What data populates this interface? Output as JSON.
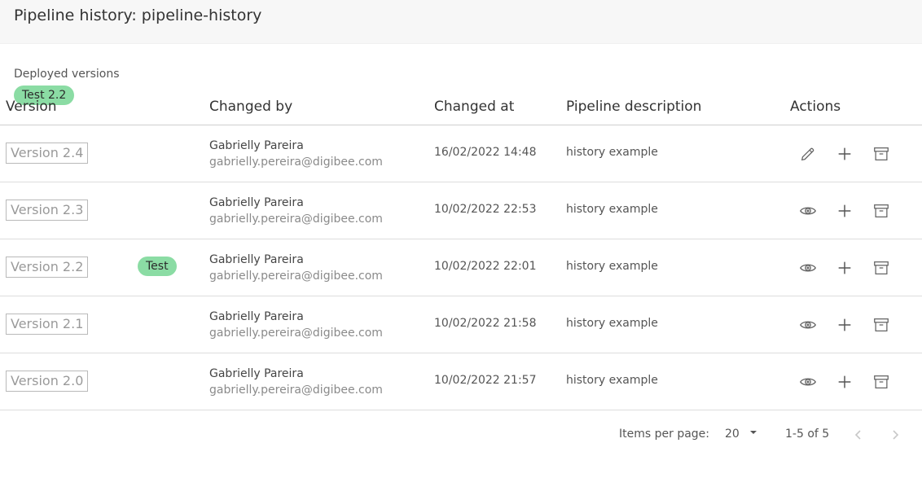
{
  "header": {
    "title": "Pipeline history: pipeline-history"
  },
  "deployed": {
    "label": "Deployed versions",
    "chip": "Test 2.2"
  },
  "table": {
    "columns": [
      "Version",
      "Changed by",
      "Changed at",
      "Pipeline description",
      "Actions"
    ],
    "rows": [
      {
        "version": "Version 2.4",
        "tag": "",
        "name": "Gabrielly Pareira",
        "email": "gabrielly.pereira@digibee.com",
        "changed_at": "16/02/2022 14:48",
        "description": "history example",
        "first_action_icon": "pencil-icon"
      },
      {
        "version": "Version 2.3",
        "tag": "",
        "name": "Gabrielly Pareira",
        "email": "gabrielly.pereira@digibee.com",
        "changed_at": "10/02/2022 22:53",
        "description": "history example",
        "first_action_icon": "eye-icon"
      },
      {
        "version": "Version 2.2",
        "tag": "Test",
        "name": "Gabrielly Pareira",
        "email": "gabrielly.pereira@digibee.com",
        "changed_at": "10/02/2022 22:01",
        "description": "history example",
        "first_action_icon": "eye-icon"
      },
      {
        "version": "Version 2.1",
        "tag": "",
        "name": "Gabrielly Pareira",
        "email": "gabrielly.pereira@digibee.com",
        "changed_at": "10/02/2022 21:58",
        "description": "history example",
        "first_action_icon": "eye-icon"
      },
      {
        "version": "Version 2.0",
        "tag": "",
        "name": "Gabrielly Pareira",
        "email": "gabrielly.pereira@digibee.com",
        "changed_at": "10/02/2022 21:57",
        "description": "history example",
        "first_action_icon": "eye-icon"
      }
    ]
  },
  "paginator": {
    "items_per_page_label": "Items per page:",
    "page_size": "20",
    "range": "1-5 of 5"
  },
  "colors": {
    "chip": "#8bdca4",
    "header_bg": "#f7f7f7"
  }
}
